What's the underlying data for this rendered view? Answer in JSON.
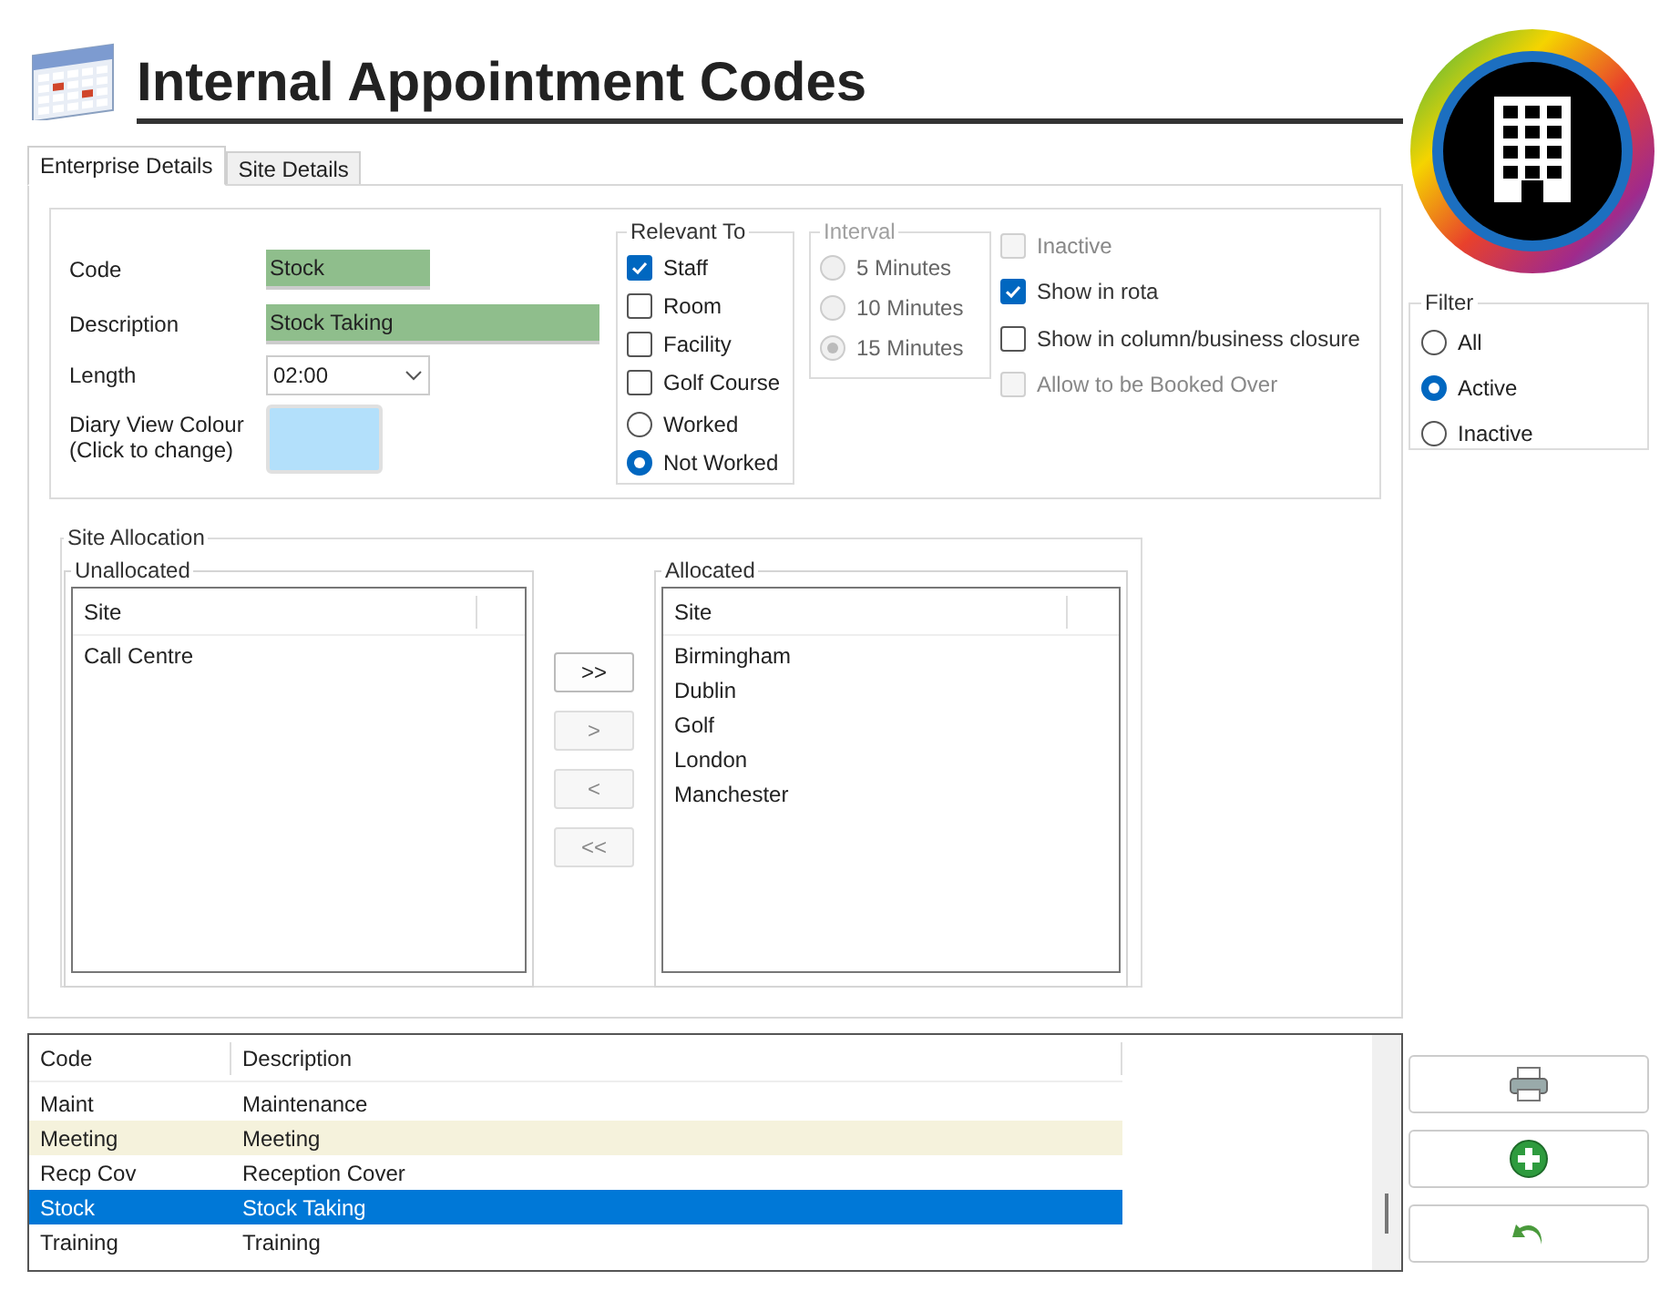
{
  "title": "Internal Appointment Codes",
  "tabs": [
    {
      "label": "Enterprise Details",
      "selected": true
    },
    {
      "label": "Site Details",
      "selected": false
    }
  ],
  "fields": {
    "code": {
      "label": "Code",
      "value": "Stock"
    },
    "description": {
      "label": "Description",
      "value": "Stock Taking"
    },
    "length": {
      "label": "Length",
      "value": "02:00"
    },
    "colour": {
      "label": "Diary View Colour\n(Click to change)",
      "color": "#b3e0fb"
    }
  },
  "relevant_to": {
    "title": "Relevant To",
    "items": [
      {
        "kind": "checkbox",
        "label": "Staff",
        "checked": true
      },
      {
        "kind": "checkbox",
        "label": "Room",
        "checked": false
      },
      {
        "kind": "checkbox",
        "label": "Facility",
        "checked": false
      },
      {
        "kind": "checkbox",
        "label": "Golf Course",
        "checked": false
      },
      {
        "kind": "radio",
        "label": "Worked",
        "selected": false
      },
      {
        "kind": "radio",
        "label": "Not Worked",
        "selected": true
      }
    ]
  },
  "interval": {
    "title": "Interval",
    "disabled": true,
    "items": [
      {
        "label": "5 Minutes",
        "selected": false
      },
      {
        "label": "10 Minutes",
        "selected": false
      },
      {
        "label": "15 Minutes",
        "selected": true
      }
    ]
  },
  "options": [
    {
      "label": "Inactive",
      "checked": false,
      "disabled": true
    },
    {
      "label": "Show in rota",
      "checked": true,
      "disabled": false
    },
    {
      "label": "Show in column/business closure",
      "checked": false,
      "disabled": false
    },
    {
      "label": "Allow to be Booked Over",
      "checked": false,
      "disabled": true
    }
  ],
  "site_allocation": {
    "title": "Site Allocation",
    "unallocated": {
      "title": "Unallocated",
      "header": "Site",
      "items": [
        "Call Centre"
      ]
    },
    "allocated": {
      "title": "Allocated",
      "header": "Site",
      "items": [
        "Birmingham",
        "Dublin",
        "Golf",
        "London",
        "Manchester"
      ]
    },
    "buttons": [
      {
        "label": ">>",
        "disabled": false
      },
      {
        "label": ">",
        "disabled": true
      },
      {
        "label": "<",
        "disabled": true
      },
      {
        "label": "<<",
        "disabled": true
      }
    ]
  },
  "codes_table": {
    "columns": [
      "Code",
      "Description"
    ],
    "rows": [
      {
        "code": "Maint",
        "description": "Maintenance",
        "highlighted": false,
        "selected": false
      },
      {
        "code": "Meeting",
        "description": "Meeting",
        "highlighted": true,
        "selected": false
      },
      {
        "code": "Recp Cov",
        "description": "Reception Cover",
        "highlighted": false,
        "selected": false
      },
      {
        "code": "Stock",
        "description": "Stock Taking",
        "highlighted": false,
        "selected": true
      },
      {
        "code": "Training",
        "description": "Training",
        "highlighted": false,
        "selected": false
      }
    ]
  },
  "filter": {
    "title": "Filter",
    "items": [
      {
        "label": "All",
        "selected": false
      },
      {
        "label": "Active",
        "selected": true
      },
      {
        "label": "Inactive",
        "selected": false
      }
    ]
  }
}
